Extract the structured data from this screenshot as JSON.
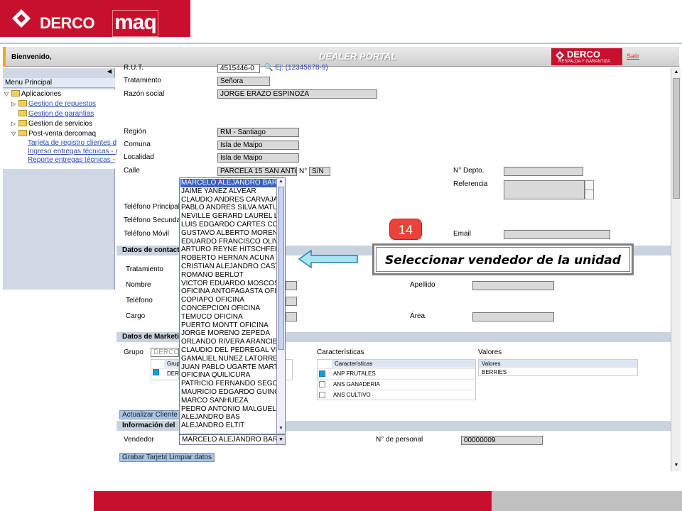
{
  "logo": {
    "brand_a": "DERCO",
    "brand_b": "maq"
  },
  "header": {
    "welcome": "Bienvenido,",
    "title": "DEALER PORTAL",
    "derco_brand": "DERCO",
    "derco_slogan": "RESPALDA Y GARANTIZA",
    "salir": "Salir"
  },
  "menu": {
    "head": "Menu Principal",
    "items": {
      "aplicaciones": "Aplicaciones",
      "repuestos": "Gestion de repuestos",
      "garantias": "Gestion de garantias",
      "servicios": "Gestion de servicios",
      "postventa": "Post-venta dercomaq",
      "sub1": "Tarjeta de registro clientes d",
      "sub2": "Ingreso entregas técnicas - (",
      "sub3": "Reporte entregas técnicas -"
    }
  },
  "form": {
    "rut_label": "R.U.T.",
    "rut_value": "4515446-0",
    "rut_example": "Ej: (12345678-9)",
    "tratamiento_label": "Tratamiento",
    "tratamiento_value": "Señora",
    "razon_label": "Razón social",
    "razon_value": "JORGE ERAZO ESPINOZA",
    "region_label": "Región",
    "region_value": "RM - Santiago",
    "comuna_label": "Comuna",
    "comuna_value": "Isla de Maipo",
    "localidad_label": "Localidad",
    "localidad_value": "Isla de  Maipo",
    "calle_label": "Calle",
    "calle_value": "PARCELA 15 SAN ANTO",
    "numero_label": "N°",
    "numero_value": "S/N",
    "depto_label": "N° Depto.",
    "referencia_label": "Referencia",
    "tel_principal_label": "Teléfono Principal",
    "tel_secundario_label": "Teléfono Secunda",
    "tel_movil_label": "Teléfono Móvil",
    "email_label": "Email"
  },
  "contacto": {
    "section": "Datos de contact",
    "tratamiento_label": "Tratamiento",
    "nombre_label": "Nombre",
    "telefono_label": "Teléfono",
    "cargo_label": "Cargo",
    "apellido_label": "Apellido",
    "area_label": "Área"
  },
  "marketing": {
    "section": "Datos de Marketi",
    "grupo_label": "Grupo",
    "grupo_value": "DERCO",
    "grupo_col": "Grup",
    "grupo_row": "DERC",
    "caracteristicas_label": "Características",
    "valores_label": "Valores",
    "car_header": "Características",
    "car_rows": [
      "ANP FRUTALES",
      "ANS GANADERIA",
      "ANS CULTIVO"
    ],
    "val_header": "Valores",
    "val_rows": [
      "BERRIES"
    ],
    "actualizar_btn": "Actualizar Cliente"
  },
  "informacion": {
    "section": "Información del",
    "vendedor_label": "Vendedor",
    "vendedor_value": "MARCELO ALEJANDRO BAR",
    "personal_label": "N° de personal",
    "personal_value": "00000009"
  },
  "buttons": {
    "grabar": "Grabar Tarjeta",
    "limpiar": "Limpiar datos"
  },
  "dropdown_options": [
    "MARCELO ALEJANDRO BAR",
    "JAIME YANEZ ALVEAR",
    "CLAUDIO ANDRES CARVAJA",
    "PABLO ANDRES SILVA MATU",
    "NEVILLE GERARD LAUREL LI",
    "LUIS EDGARDO CARTES CON",
    "GUSTAVO ALBERTO MOREN",
    "EDUARDO FRANCISCO OLIVE",
    "ARTURO REYNE HITSCHFELD",
    "ROBERTO HERNAN ACUÑA S",
    "CRISTIAN ALEJANDRO CASTI",
    "ROMANO BERLOT",
    "VICTOR EDUARDO MOSCOSO",
    "OFICINA ANTOFAGASTA OFIC",
    "COPIAPO OFICINA",
    "CONCEPCION OFICINA",
    "TEMUCO OFICINA",
    "PUERTO MONTT OFICINA",
    "JORGE MORENO ZEPEDA",
    "ORLANDO RIVERA ARANCIBI",
    "CLAUDIO DEL PEDREGAL VIL",
    "GAMALIEL NUÑEZ LATORRE",
    "JUAN PABLO UGARTE MART",
    "OFICINA QUILICURA",
    "PATRICIO FERNANDO SEGOV",
    "MAURICIO EDGARDO GUINCH",
    "MARCO SANHUEZA",
    "PEDRO ANTONIO MALGUELL",
    "ALEJANDRO BAS",
    "ALEJANDRO ELTIT"
  ],
  "annotation": {
    "step": "14",
    "text": "Seleccionar vendedor de la unidad"
  },
  "colors": {
    "brand_red": "#c8102e",
    "badge_red": "#e8423b",
    "section_blue": "#c9d3df",
    "selection_blue": "#3a5fc8"
  }
}
